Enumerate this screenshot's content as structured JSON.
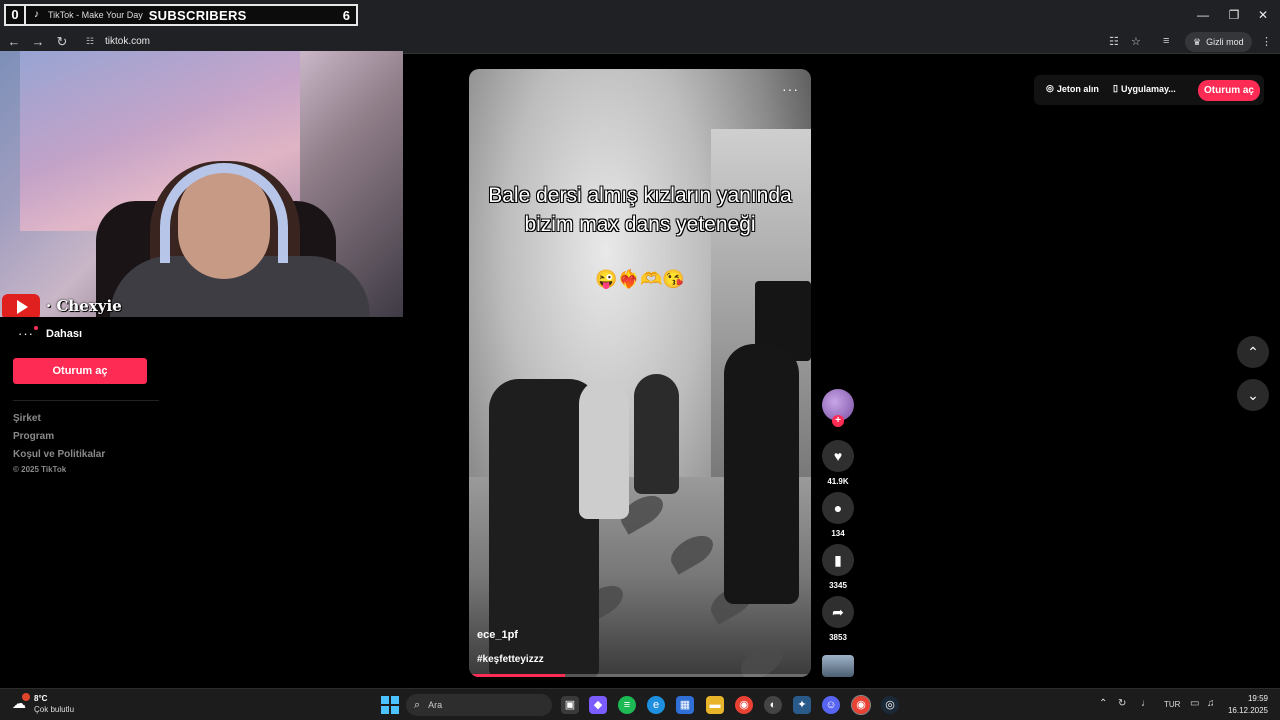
{
  "overlay": {
    "subscriber_count_left": "0",
    "tab_title": "TikTok - Make Your Day",
    "subscribers_label": "SUBSCRIBERS",
    "subscriber_count_right": "6",
    "channel_name": "Chexyie"
  },
  "browser": {
    "url": "tiktok.com",
    "incognito_label": "Gizli mod"
  },
  "sidebar": {
    "more_label": "Dahası",
    "login_label": "Oturum aç",
    "footer_links": [
      "Şirket",
      "Program",
      "Koşul ve Politikalar"
    ],
    "copyright": "© 2025 TikTok"
  },
  "video": {
    "caption": "Bale dersi almış kızların yanında bizim max dans yeteneği",
    "emoji": "😜❤️‍🔥🫶😘",
    "author": "ece_1pf",
    "hashtag": "#keşfetteyizzz",
    "progress": 0.28,
    "likes": "41.9K",
    "comments": "134",
    "saves": "3345",
    "shares": "3853"
  },
  "topbar": {
    "coins_label": "Jeton alın",
    "app_label": "Uygulamay...",
    "login_label": "Oturum aç"
  },
  "taskbar": {
    "temperature": "8°C",
    "weather": "Çok bulutlu",
    "search_placeholder": "Ara",
    "language": "TUR",
    "time": "19:59",
    "date": "16.12.2025"
  },
  "colors": {
    "tiktok_red": "#fe2c55",
    "background": "#000000",
    "youtube_red": "#e01f1f"
  }
}
